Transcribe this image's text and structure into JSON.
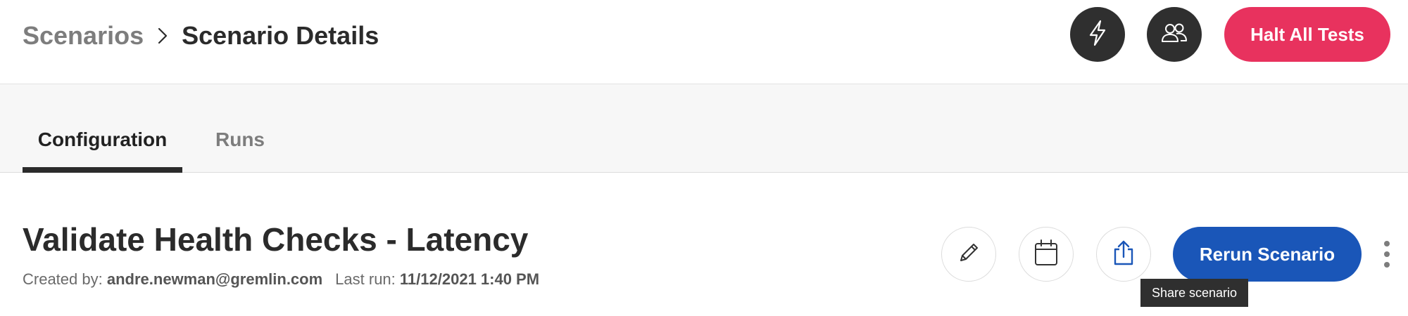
{
  "header": {
    "breadcrumb": {
      "parent": "Scenarios",
      "current": "Scenario Details"
    },
    "halt_button": "Halt All Tests",
    "colors": {
      "halt": "#e8325e",
      "round_button": "#2f2f2f"
    }
  },
  "tabs": [
    {
      "label": "Configuration",
      "active": true
    },
    {
      "label": "Runs",
      "active": false
    }
  ],
  "scenario": {
    "title": "Validate Health Checks - Latency",
    "created_by_label": "Created by:",
    "created_by": "andre.newman@gremlin.com",
    "last_run_label": "Last run:",
    "last_run": "11/12/2021 1:40 PM"
  },
  "actions": {
    "rerun_button": "Rerun Scenario",
    "icons": [
      "lightning-bolt-icon",
      "team-icon",
      "pencil-icon",
      "calendar-icon",
      "share-icon",
      "more-vertical-icon"
    ],
    "accent": "#1a56b8"
  },
  "tooltip": {
    "text": "Share scenario"
  }
}
